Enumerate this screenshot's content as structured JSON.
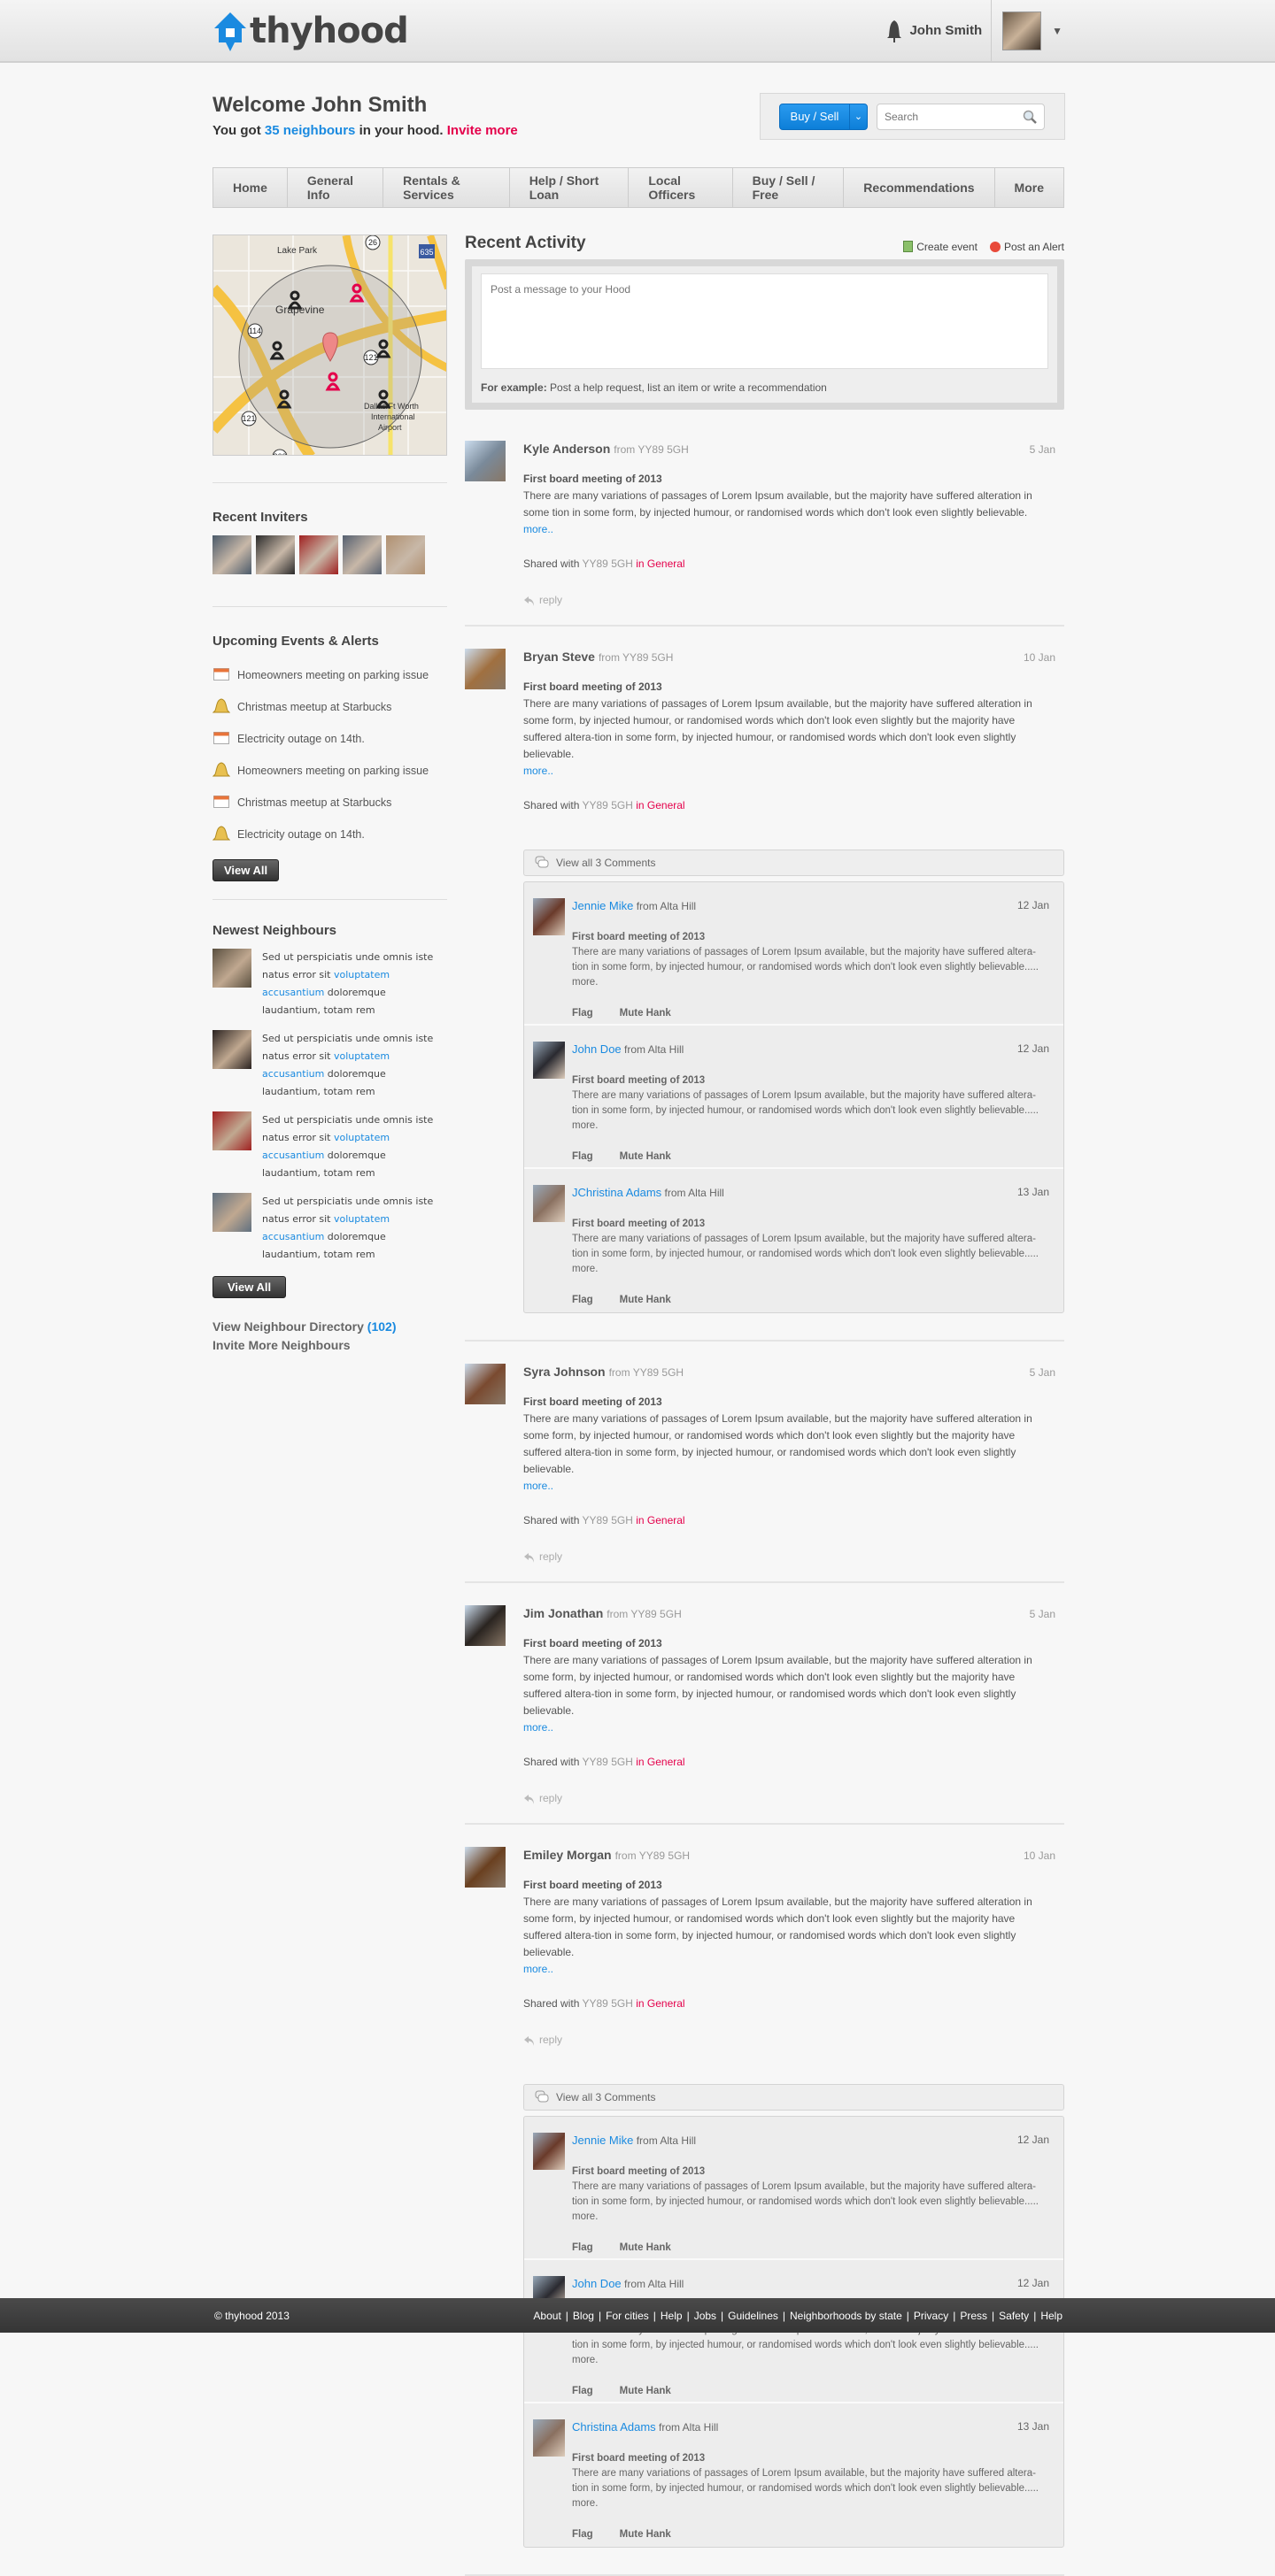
{
  "header": {
    "logo": "thyhood",
    "user_name": "John Smith"
  },
  "welcome": {
    "title": "Welcome John Smith",
    "prefix": "You got ",
    "count_link": "35 neighbours",
    "middle": " in your hood. ",
    "invite_link": "Invite more"
  },
  "toolbar": {
    "buy_sell_label": "Buy / Sell",
    "search_placeholder": "Search"
  },
  "nav": [
    "Home",
    "General Info",
    "Rentals & Services",
    "Help / Short Loan",
    "Local Officers",
    "Buy / Sell / Free",
    "Recommendations",
    "More"
  ],
  "map": {
    "labels": [
      "Lake Park",
      "Grapevine",
      "Dallas/Ft Worth",
      "International",
      "Airport"
    ],
    "routes": [
      "114",
      "121",
      "121",
      "360",
      "635",
      "26"
    ]
  },
  "sidebar": {
    "inviters_title": "Recent Inviters",
    "inviter_colors": [
      "#4a5a6a",
      "#2a2a2a",
      "#a02020",
      "#556070",
      "#b09070"
    ],
    "events_title": "Upcoming Events & Alerts",
    "events": [
      {
        "icon": "calendar",
        "label": "Homeowners meeting on parking issue"
      },
      {
        "icon": "bell",
        "label": "Christmas meetup at Starbucks"
      },
      {
        "icon": "calendar",
        "label": "Electricity outage on 14th."
      },
      {
        "icon": "bell",
        "label": "Homeowners meeting on parking issue"
      },
      {
        "icon": "calendar",
        "label": "Christmas meetup at Starbucks"
      },
      {
        "icon": "bell",
        "label": "Electricity outage on 14th."
      }
    ],
    "view_all": "View All",
    "neighbours_title": "Newest Neighbours",
    "neighbours": [
      {
        "color": "#5a5040",
        "pre": "Sed ut perspiciatis unde omnis iste natus error sit ",
        "link": "voluptatem accusantium",
        "post": " doloremque laudantium, totam rem"
      },
      {
        "color": "#2a2220",
        "pre": "Sed ut perspiciatis unde omnis iste natus error sit ",
        "link": "voluptatem accusantium",
        "post": " doloremque laudantium, totam rem"
      },
      {
        "color": "#a02020",
        "pre": "Sed ut perspiciatis unde omnis iste natus error sit ",
        "link": "voluptatem accusantium",
        "post": " doloremque laudantium, totam rem"
      },
      {
        "color": "#607080",
        "pre": "Sed ut perspiciatis unde omnis iste natus error sit ",
        "link": "voluptatem accusantium",
        "post": " doloremque laudantium, totam rem"
      }
    ],
    "view_all_2": "View All",
    "directory_label": "View Neighbour Directory",
    "directory_count": "(102)",
    "invite_more": "Invite More Neighbours"
  },
  "activity": {
    "title": "Recent Activity",
    "create_event": "Create event",
    "post_alert": "Post an Alert",
    "composer_placeholder": "Post a message to your Hood",
    "example_label": "For example:",
    "example_text": " Post a help request, list an item or write a recommendation",
    "posts": [
      {
        "name": "Kyle Anderson",
        "from": "from YY89 5GH",
        "date": "5 Jan",
        "avatar": "#7a8a9a",
        "title": "First board meeting of 2013",
        "body": "There are many variations of passages of Lorem Ipsum available, but the majority have suffered alteration in some tion in some form, by injected humour, or randomised words which don't look even slightly believable.",
        "more": "more..",
        "shared_prefix": "Shared with ",
        "shared_loc": "YY89 5GH",
        "shared_cat": " in General",
        "reply": "reply"
      },
      {
        "name": "Bryan Steve",
        "from": "from YY89 5GH",
        "date": "10 Jan",
        "avatar": "#a07040",
        "title": "First board meeting of 2013",
        "body": "There are many variations of passages of Lorem Ipsum available, but the majority have suffered alteration in some form, by injected humour, or randomised words which don't look even slightly but the majority have suffered altera-tion in some form, by injected humour, or randomised words which don't look even slightly believable.",
        "more": "more..",
        "shared_prefix": "Shared with ",
        "shared_loc": "YY89 5GH",
        "shared_cat": " in General",
        "view_all_comments": "View all 3 Comments",
        "comments": [
          {
            "name": "Jennie Mike",
            "from": "from Alta Hill",
            "date": "12 Jan",
            "avatar": "#6a3a2a",
            "title": "First board meeting of 2013",
            "body": "There are many variations of passages of Lorem Ipsum available, but the majority have suffered altera-tion in some form, by injected humour, or randomised words which don't look even slightly believable..... more.",
            "flag": "Flag",
            "mute": "Mute Hank"
          },
          {
            "name": "John Doe",
            "from": "from Alta Hill",
            "date": "12 Jan",
            "avatar": "#2a2a30",
            "title": "First board meeting of 2013",
            "body": "There are many variations of passages of Lorem Ipsum available, but the majority have suffered altera-tion in some form, by injected humour, or randomised words which don't look even slightly believable..... more.",
            "flag": "Flag",
            "mute": "Mute Hank"
          },
          {
            "name": "JChristina Adams",
            "from": "from Alta Hill",
            "date": "13 Jan",
            "avatar": "#8a7060",
            "title": "First board meeting of 2013",
            "body": "There are many variations of passages of Lorem Ipsum available, but the majority have suffered altera-tion in some form, by injected humour, or randomised words which don't look even slightly believable..... more.",
            "flag": "Flag",
            "mute": "Mute Hank"
          }
        ]
      },
      {
        "name": "Syra Johnson",
        "from": "from YY89 5GH",
        "date": "5 Jan",
        "avatar": "#7a4a30",
        "title": "First board meeting of 2013",
        "body": "There are many variations of passages of Lorem Ipsum available, but the majority have suffered alteration in some form, by injected humour, or randomised words which don't look even slightly but the majority have suffered altera-tion in some form, by injected humour, or randomised words which don't look even slightly believable.",
        "more": "more..",
        "shared_prefix": "Shared with ",
        "shared_loc": "YY89 5GH",
        "shared_cat": " in General",
        "reply": "reply"
      },
      {
        "name": "Jim Jonathan",
        "from": "from YY89 5GH",
        "date": "5 Jan",
        "avatar": "#2a2420",
        "title": "First board meeting of 2013",
        "body": "There are many variations of passages of Lorem Ipsum available, but the majority have suffered alteration in some form, by injected humour, or randomised words which don't look even slightly but the majority have suffered altera-tion in some form, by injected humour, or randomised words which don't look even slightly believable.",
        "more": "more..",
        "shared_prefix": "Shared with ",
        "shared_loc": "YY89 5GH",
        "shared_cat": " in General",
        "reply": "reply"
      },
      {
        "name": "Emiley Morgan",
        "from": "from YY89 5GH",
        "date": "10 Jan",
        "avatar": "#6a4020",
        "title": "First board meeting of 2013",
        "body": "There are many variations of passages of Lorem Ipsum available, but the majority have suffered alteration in some form, by injected humour, or randomised words which don't look even slightly but the majority have suffered altera-tion in some form, by injected humour, or randomised words which don't look even slightly believable.",
        "more": "more..",
        "shared_prefix": "Shared with ",
        "shared_loc": "YY89 5GH",
        "shared_cat": " in General",
        "reply": "reply",
        "view_all_comments": "View all 3 Comments",
        "comments": [
          {
            "name": "Jennie Mike",
            "from": "from Alta Hill",
            "date": "12 Jan",
            "avatar": "#6a3a2a",
            "title": "First board meeting of 2013",
            "body": "There are many variations of passages of Lorem Ipsum available, but the majority have suffered altera-tion in some form, by injected humour, or randomised words which don't look even slightly believable..... more.",
            "flag": "Flag",
            "mute": "Mute Hank"
          },
          {
            "name": "John Doe",
            "from": "from Alta Hill",
            "date": "12 Jan",
            "avatar": "#2a2a30",
            "title": "First board meeting of 2013",
            "body": "There are many variations of passages of Lorem Ipsum available, but the majority have suffered altera-tion in some form, by injected humour, or randomised words which don't look even slightly believable..... more.",
            "flag": "Flag",
            "mute": "Mute Hank"
          },
          {
            "name": "Christina Adams",
            "from": "from Alta Hill",
            "date": "13 Jan",
            "avatar": "#8a7060",
            "title": "First board meeting of 2013",
            "body": "There are many variations of passages of Lorem Ipsum available, but the majority have suffered altera-tion in some form, by injected humour, or randomised words which don't look even slightly believable..... more.",
            "flag": "Flag",
            "mute": "Mute Hank"
          }
        ]
      }
    ]
  },
  "footer": {
    "copyright": "© thyhood 2013",
    "links": [
      "About",
      "Blog",
      "For cities",
      "Help",
      "Jobs",
      "Guidelines",
      "Neighborhoods by state",
      "Privacy",
      "Press",
      "Safety",
      "Help"
    ]
  },
  "colors": {
    "accent_blue": "#1a8ae0",
    "accent_red": "#e4004b",
    "footer": "#404040"
  }
}
